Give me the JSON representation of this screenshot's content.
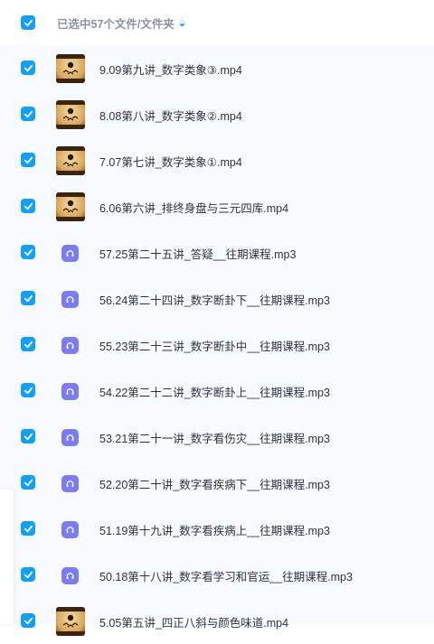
{
  "header": {
    "selection_text": "已选中57个文件/文件夹"
  },
  "files": [
    {
      "name": "9.09第九讲_数字类象③.mp4",
      "type": "video"
    },
    {
      "name": "8.08第八讲_数字类象②.mp4",
      "type": "video"
    },
    {
      "name": "7.07第七讲_数字类象①.mp4",
      "type": "video"
    },
    {
      "name": "6.06第六讲_排终身盘与三元四库.mp4",
      "type": "video"
    },
    {
      "name": "57.25第二十五讲_答疑__往期课程.mp3",
      "type": "audio"
    },
    {
      "name": "56.24第二十四讲_数字断卦下__往期课程.mp3",
      "type": "audio"
    },
    {
      "name": "55.23第二十三讲_数字断卦中__往期课程.mp3",
      "type": "audio"
    },
    {
      "name": "54.22第二十二讲_数字断卦上__往期课程.mp3",
      "type": "audio"
    },
    {
      "name": "53.21第二十一讲_数字看伤灾__往期课程.mp3",
      "type": "audio"
    },
    {
      "name": "52.20第二十讲_数字看疾病下__往期课程.mp3",
      "type": "audio"
    },
    {
      "name": "51.19第十九讲_数字看疾病上__往期课程.mp3",
      "type": "audio"
    },
    {
      "name": "50.18第十八讲_数字看学习和官运__往期课程.mp3",
      "type": "audio"
    },
    {
      "name": "5.05第五讲_四正八斜与颜色味道.mp4",
      "type": "video"
    }
  ],
  "colors": {
    "checkbox": "#11a0f5",
    "audio_icon": "#7b7cf0",
    "list_bg": "#f6f9fd",
    "text": "#2b3444",
    "header_text": "#8a94a6"
  },
  "icons": {
    "checkbox": "checkmark-icon",
    "video": "video-thumbnail",
    "audio": "headphones-icon",
    "info": "info-drop-icon"
  }
}
